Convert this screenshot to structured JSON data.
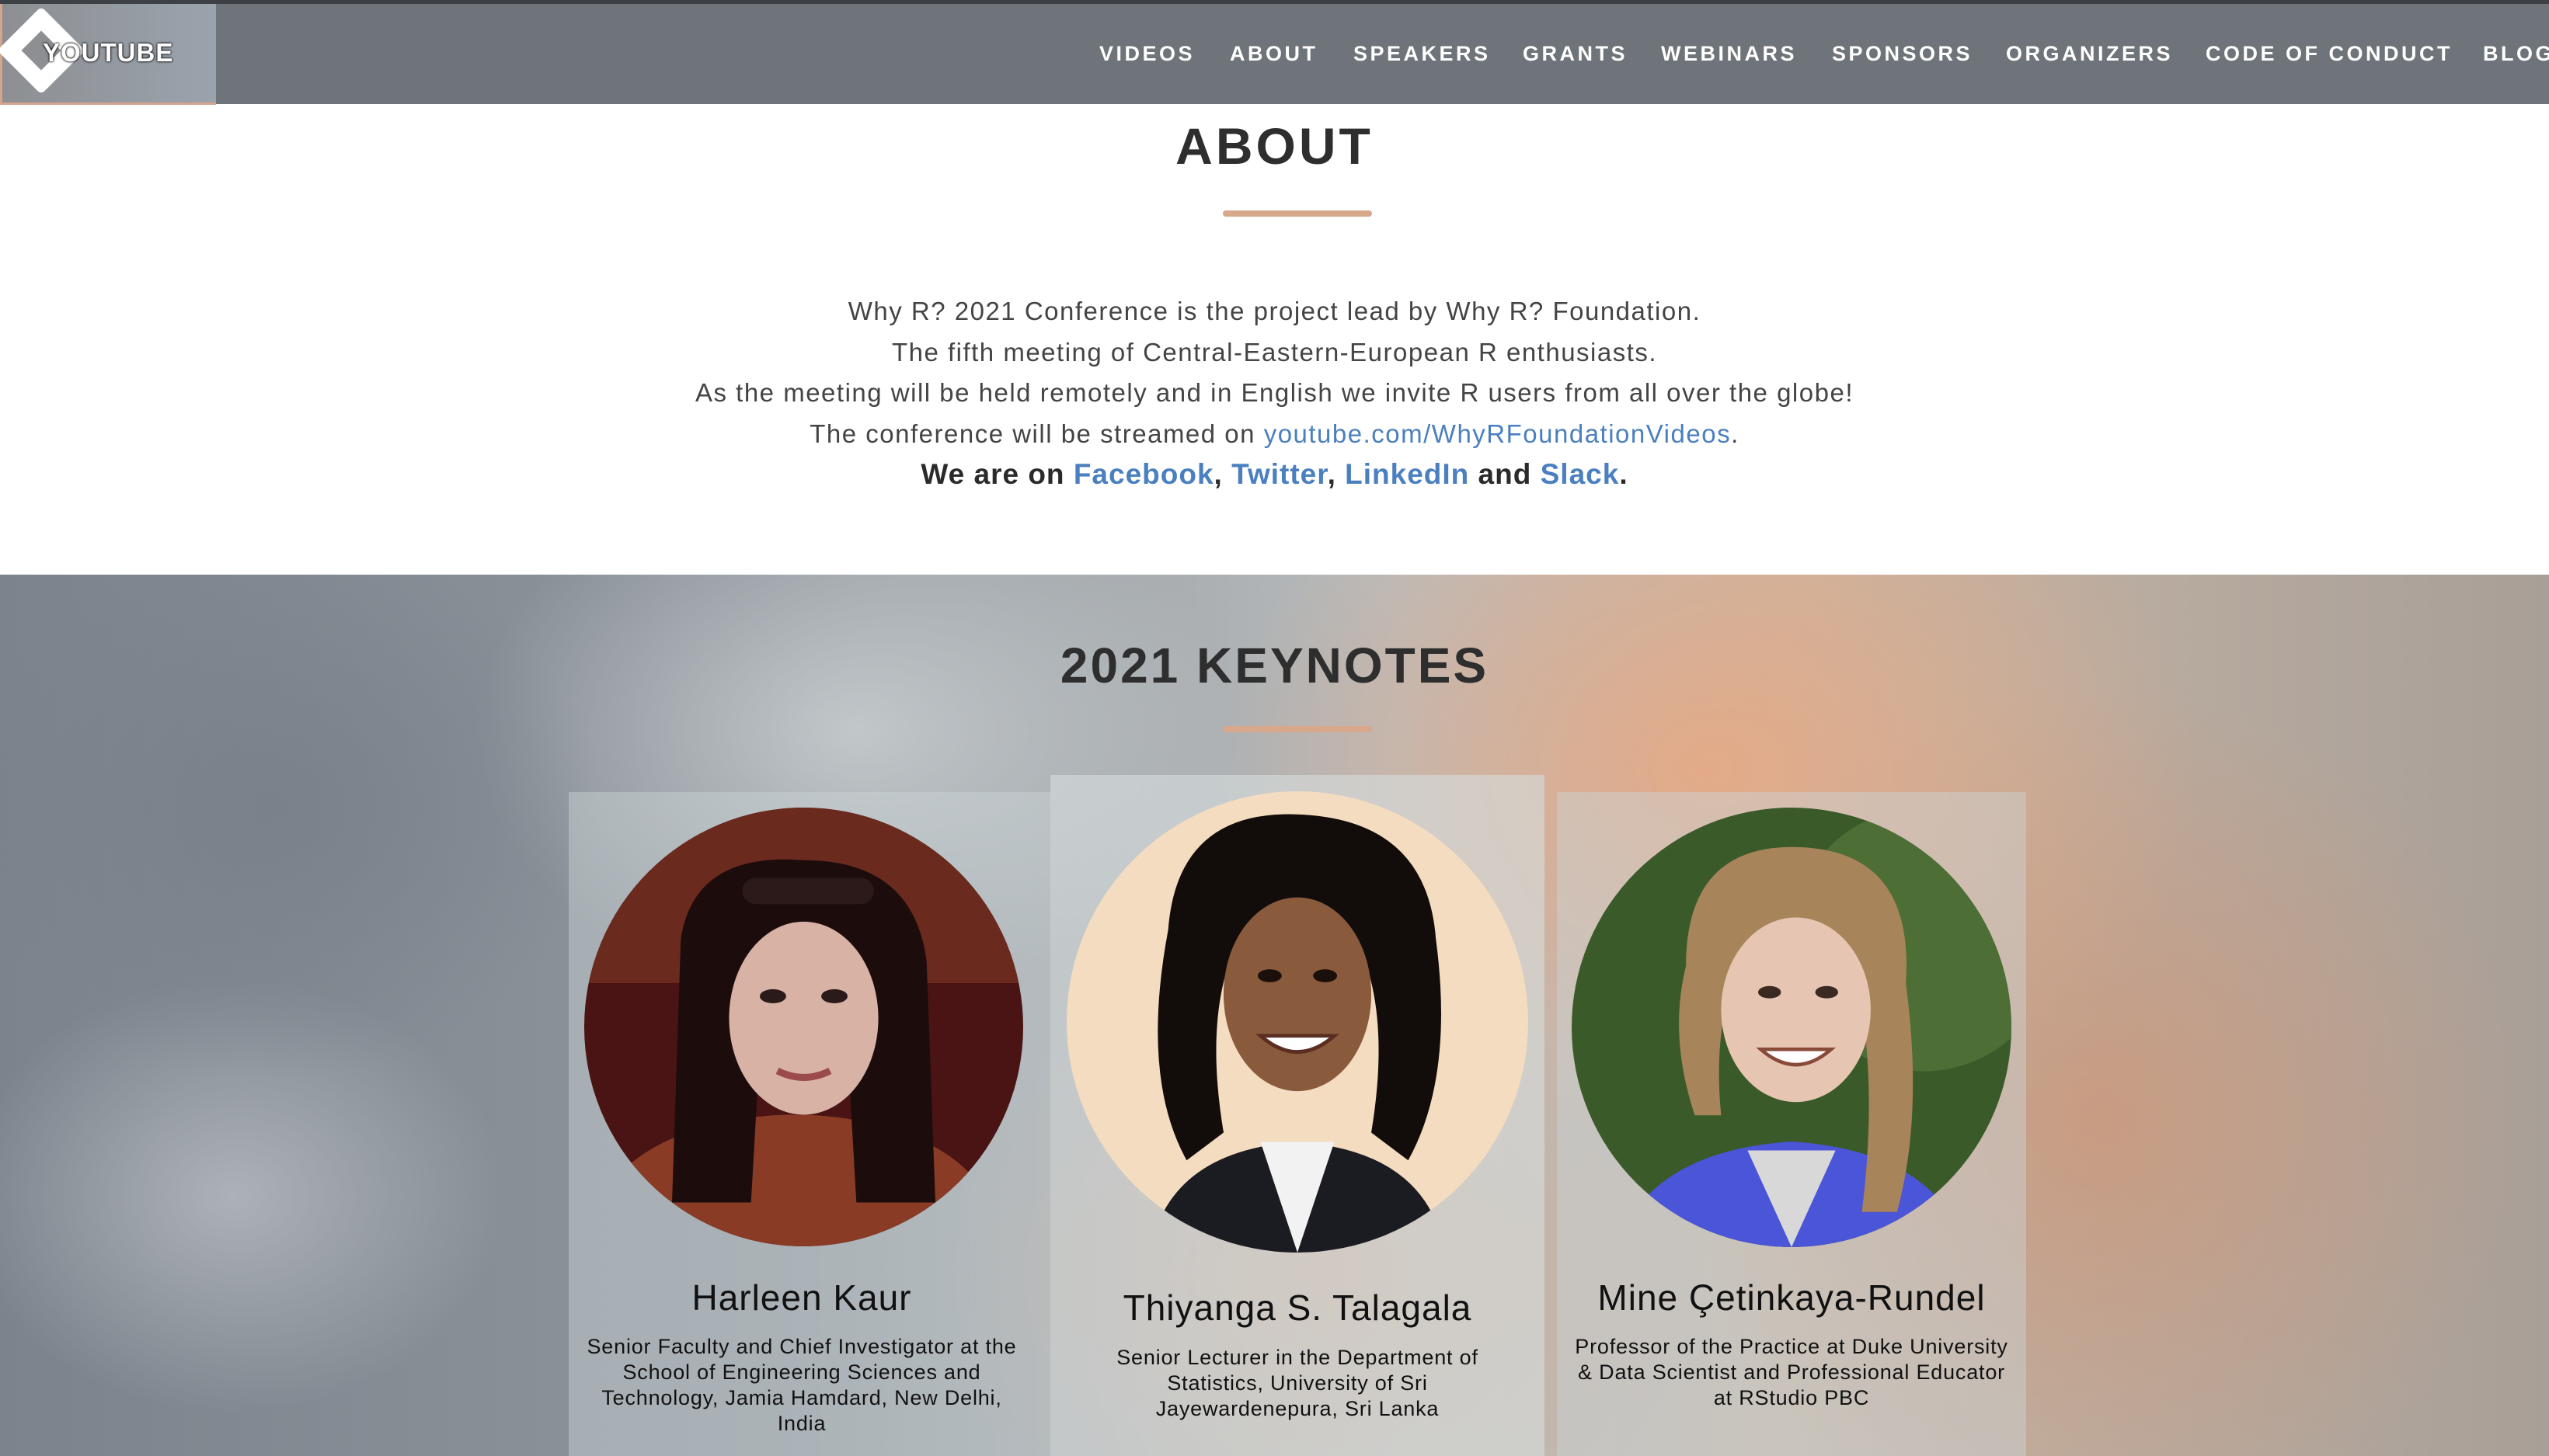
{
  "header": {
    "logo_label": "YOUTUBE",
    "nav": [
      {
        "label": "VIDEOS"
      },
      {
        "label": "ABOUT"
      },
      {
        "label": "SPEAKERS"
      },
      {
        "label": "GRANTS"
      },
      {
        "label": "WEBINARS"
      },
      {
        "label": "SPONSORS"
      },
      {
        "label": "ORGANIZERS"
      },
      {
        "label": "CODE OF CONDUCT"
      },
      {
        "label": "BLOG"
      }
    ]
  },
  "about": {
    "title": "ABOUT",
    "lines": [
      "Why R? 2021 Conference is the project lead by Why R? Foundation.",
      "The fifth meeting of Central-Eastern-European R enthusiasts.",
      "As the meeting will be held remotely and in English we invite R users from all over the globe!"
    ],
    "stream_prefix": "The conference will be streamed on ",
    "stream_link": "youtube.com/WhyRFoundationVideos",
    "stream_suffix": ".",
    "social_prefix": "We are on ",
    "social_links": {
      "facebook": "Facebook",
      "twitter": "Twitter",
      "linkedin": "LinkedIn",
      "slack": "Slack"
    },
    "comma": ",",
    "and": " and ",
    "period": "."
  },
  "keynotes": {
    "title": "2021 KEYNOTES",
    "speakers": [
      {
        "name": "Harleen Kaur",
        "bio": [
          "Senior Faculty and Chief Investigator at the",
          "School of Engineering Sciences and",
          "Technology, Jamia Hamdard, New Delhi,",
          "India"
        ]
      },
      {
        "name": "Thiyanga S. Talagala",
        "bio": [
          "Senior Lecturer in the Department of",
          "Statistics, University of Sri",
          "Jayewardenepura, Sri Lanka"
        ]
      },
      {
        "name": "Mine Çetinkaya-Rundel",
        "bio": [
          "Professor of the Practice at Duke University",
          "& Data Scientist and Professional Educator",
          "at RStudio PBC"
        ]
      }
    ]
  },
  "colors": {
    "accent": "#d8a88c",
    "link": "#4a7fc0",
    "nav_bg": "#6e7479"
  }
}
